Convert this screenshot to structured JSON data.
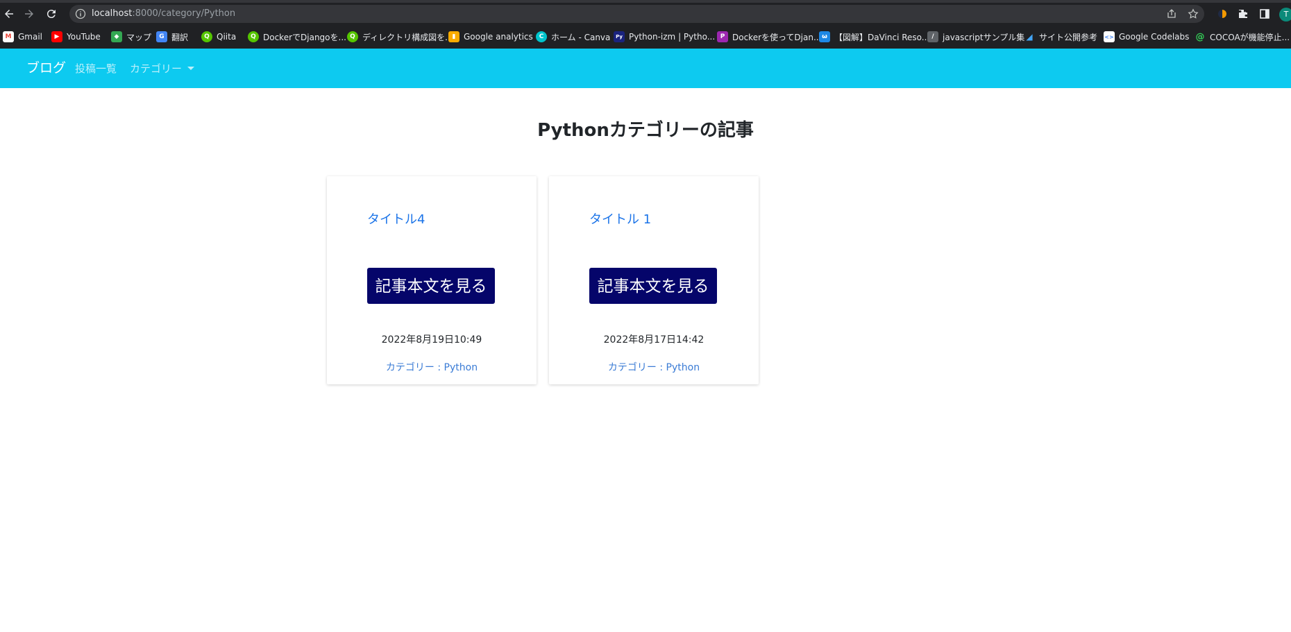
{
  "browser": {
    "url_host": "localhost",
    "url_path": ":8000/category/Python",
    "avatar_initial": "T",
    "bookmarks": [
      {
        "label": "Gmail",
        "icon": "gmail-icon",
        "color": "#ea4335",
        "glyph": "M"
      },
      {
        "label": "YouTube",
        "icon": "youtube-icon",
        "color": "#ff0000",
        "glyph": "▶"
      },
      {
        "label": "マップ",
        "icon": "maps-icon",
        "color": "#34a853",
        "glyph": "◆"
      },
      {
        "label": "翻訳",
        "icon": "translate-icon",
        "color": "#4285f4",
        "glyph": "G"
      },
      {
        "label": "Qiita",
        "icon": "qiita-icon",
        "color": "#55c500",
        "glyph": "Q"
      },
      {
        "label": "DockerでDjangoを...",
        "icon": "qiita-icon",
        "color": "#55c500",
        "glyph": "Q"
      },
      {
        "label": "ディレクトリ構成図を...",
        "icon": "qiita-icon",
        "color": "#55c500",
        "glyph": "Q"
      },
      {
        "label": "Google analytics",
        "icon": "analytics-icon",
        "color": "#f9ab00",
        "glyph": "▮"
      },
      {
        "label": "ホーム - Canva",
        "icon": "canva-icon",
        "color": "#00c4cc",
        "glyph": "C"
      },
      {
        "label": "Python-izm | Pytho...",
        "icon": "python-izm-icon",
        "color": "#1a237e",
        "glyph": "Py"
      },
      {
        "label": "Dockerを使ってDjan...",
        "icon": "docker-article-icon",
        "color": "#9c27b0",
        "glyph": "P"
      },
      {
        "label": "【図解】DaVinci Reso...",
        "icon": "davinci-icon",
        "color": "#1e88e5",
        "glyph": "ω"
      },
      {
        "label": "javascriptサンプル集",
        "icon": "javascript-icon",
        "color": "#5f6368",
        "glyph": "/"
      },
      {
        "label": "サイト公開参考",
        "icon": "site-icon",
        "color": "#42a5f5",
        "glyph": "◢"
      },
      {
        "label": "Google Codelabs",
        "icon": "codelabs-icon",
        "color": "#4285f4",
        "glyph": "<>"
      },
      {
        "label": "COCOAが機能停止...",
        "icon": "cocoa-icon",
        "color": "#0f9d58",
        "glyph": "@"
      }
    ]
  },
  "site": {
    "brand": "ブログ",
    "nav": {
      "posts": "投稿一覧",
      "category": "カテゴリー"
    },
    "accent_color": "#0dcaf0",
    "button_color": "#05056a"
  },
  "main": {
    "title": "Pythonカテゴリーの記事",
    "cards": [
      {
        "title": "タイトル4",
        "button": "記事本文を見る",
        "date": "2022年8月19日10:49",
        "category": "カテゴリー : Python"
      },
      {
        "title": "タイトル 1",
        "button": "記事本文を見る",
        "date": "2022年8月17日14:42",
        "category": "カテゴリー : Python"
      }
    ]
  }
}
